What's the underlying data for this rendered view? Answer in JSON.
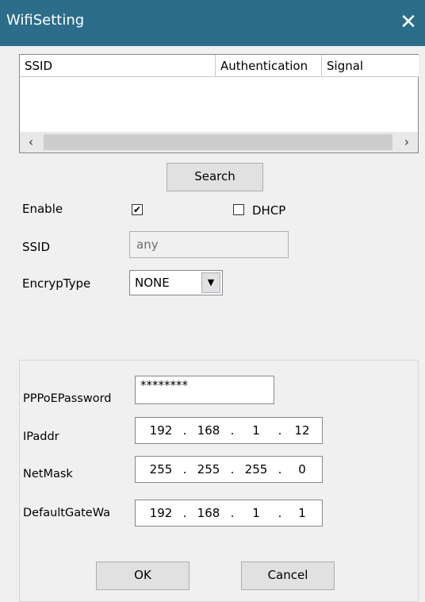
{
  "window": {
    "title": "WifiSetting",
    "close_icon": "close-icon"
  },
  "list": {
    "columns": [
      "SSID",
      "Authentication",
      "Signal"
    ],
    "rows": [],
    "scroll_left": "‹",
    "scroll_right": "›"
  },
  "search_label": "Search",
  "enable": {
    "label": "Enable",
    "checked": true,
    "mark": "✔"
  },
  "dhcp": {
    "label": "DHCP",
    "checked": false
  },
  "ssid": {
    "label": "SSID",
    "value": "any"
  },
  "encryp_type": {
    "label": "EncrypType",
    "value": "NONE",
    "arrow": "▼"
  },
  "network": {
    "pppoe_label": "PPPoEPassword",
    "pppoe_value": "********",
    "ipaddr_label": "IPaddr",
    "ipaddr": [
      "192",
      "168",
      "1",
      "12"
    ],
    "netmask_label": "NetMask",
    "netmask": [
      "255",
      "255",
      "255",
      "0"
    ],
    "gateway_label": "DefaultGateWa",
    "gateway": [
      "192",
      "168",
      "1",
      "1"
    ],
    "dot": "."
  },
  "ok_label": "OK",
  "cancel_label": "Cancel"
}
